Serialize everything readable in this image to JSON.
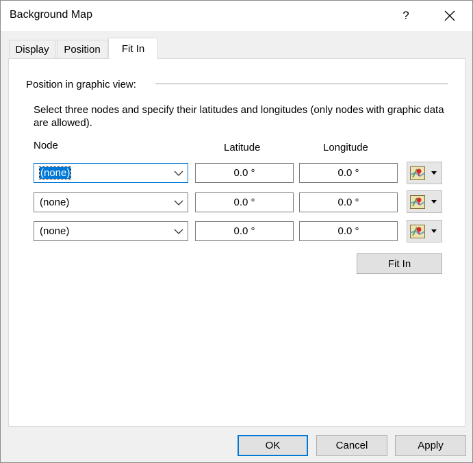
{
  "window": {
    "title": "Background Map",
    "help_label": "?"
  },
  "tabs": [
    {
      "label": "Display"
    },
    {
      "label": "Position"
    },
    {
      "label": "Fit In"
    }
  ],
  "fit_in": {
    "group_label": "Position in graphic view:",
    "instruction": "Select three nodes and specify their latitudes and longitudes (only nodes with graphic data are allowed).",
    "headers": {
      "node": "Node",
      "latitude": "Latitude",
      "longitude": "Longitude"
    },
    "rows": [
      {
        "node": "(none)",
        "latitude": "0.0 °",
        "longitude": "0.0 °"
      },
      {
        "node": "(none)",
        "latitude": "0.0 °",
        "longitude": "0.0 °"
      },
      {
        "node": "(none)",
        "latitude": "0.0 °",
        "longitude": "0.0 °"
      }
    ],
    "fit_in_button": "Fit In"
  },
  "footer": {
    "ok": "OK",
    "cancel": "Cancel",
    "apply": "Apply"
  },
  "icons": {
    "map_picker": "map-pin-icon",
    "dropdown": "chevron-down-icon",
    "close": "close-icon"
  },
  "colors": {
    "accent": "#0078d7"
  }
}
